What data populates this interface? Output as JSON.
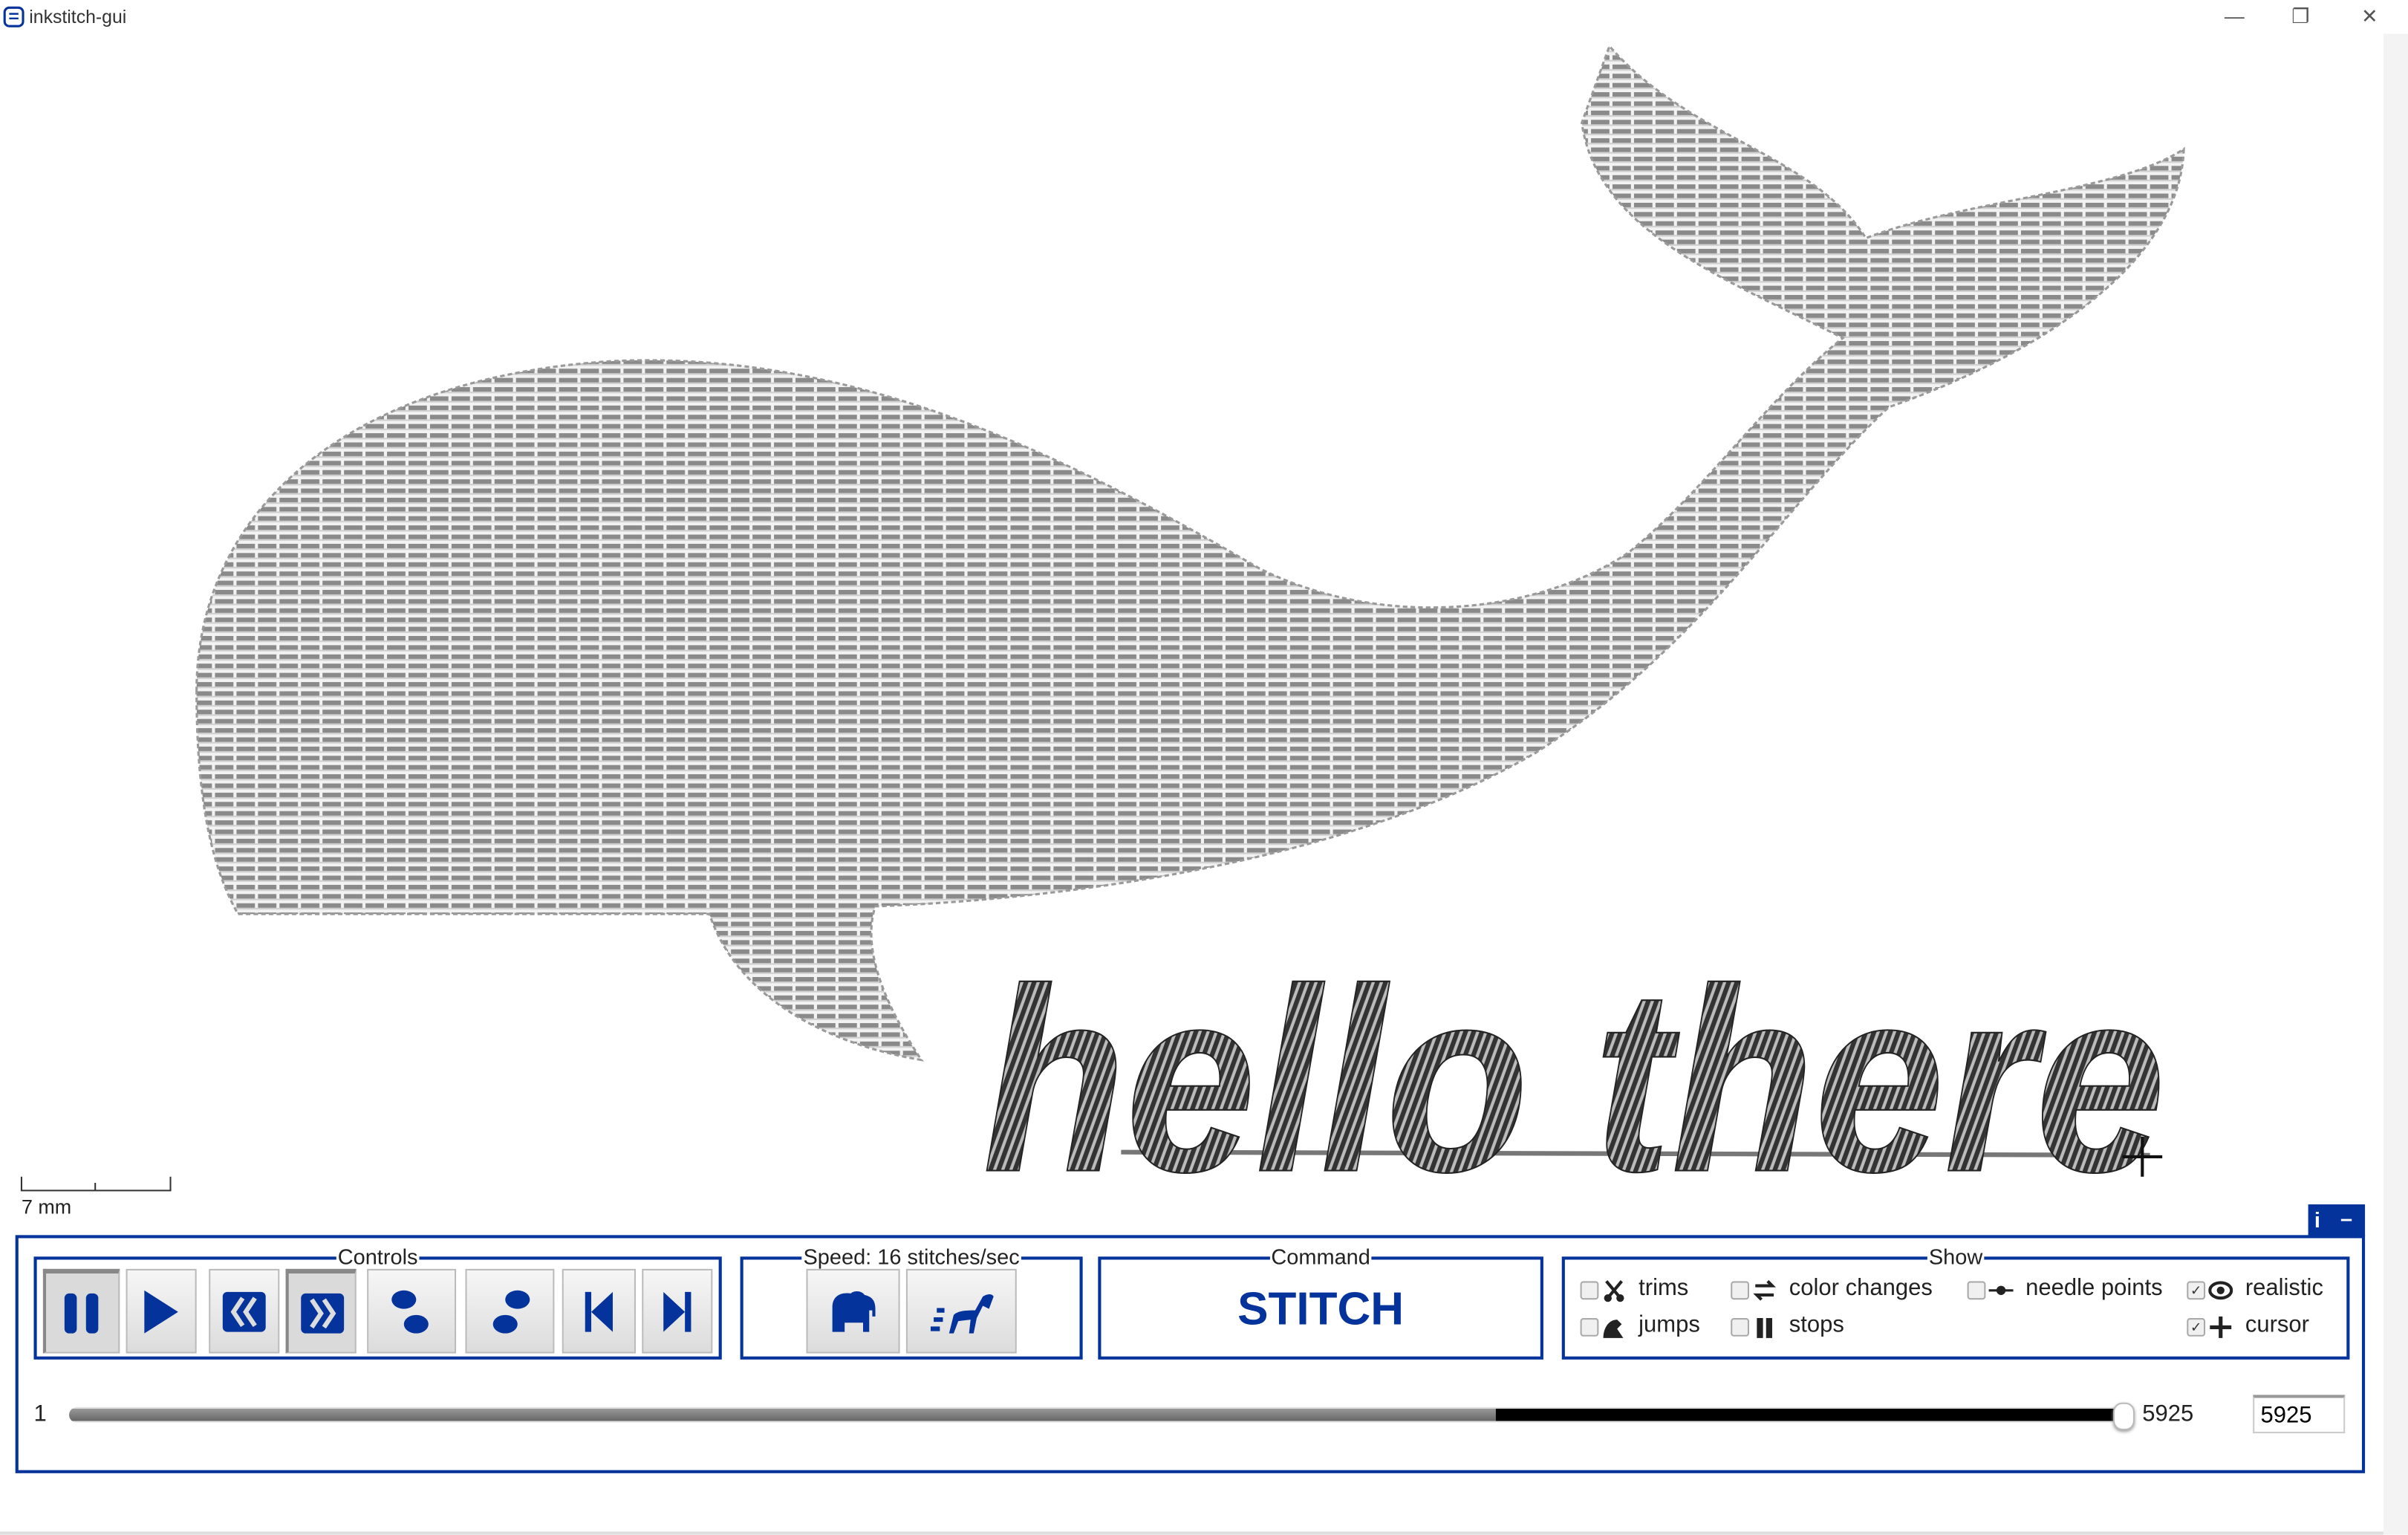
{
  "window": {
    "title": "inkstitch-gui",
    "icon": "inkstitch-app-icon",
    "controls": [
      "minimize",
      "restore",
      "close"
    ]
  },
  "canvas": {
    "design_text": "hello there",
    "design_shape": "whale",
    "scale_bar": {
      "label": "7 mm"
    },
    "cursor_icon": "crosshair-cursor"
  },
  "info_tab": {
    "info_icon": "i",
    "collapse_icon": "–"
  },
  "controls": {
    "label": "Controls",
    "buttons": [
      {
        "name": "pause",
        "icon": "pause-icon",
        "pressed": true
      },
      {
        "name": "play",
        "icon": "play-icon",
        "pressed": false
      },
      {
        "name": "reverse",
        "icon": "rewind-icon",
        "pressed": false
      },
      {
        "name": "forward",
        "icon": "fast-forward-icon",
        "pressed": true
      },
      {
        "name": "step-backward",
        "icon": "footsteps-back-icon",
        "pressed": false
      },
      {
        "name": "step-forward",
        "icon": "footsteps-forward-icon",
        "pressed": false
      },
      {
        "name": "first",
        "icon": "skip-to-start-icon",
        "pressed": false
      },
      {
        "name": "last",
        "icon": "skip-to-end-icon",
        "pressed": false
      }
    ]
  },
  "speed": {
    "label": "Speed: 16 stitches/sec",
    "buttons": [
      {
        "name": "slower",
        "icon": "elephant-icon"
      },
      {
        "name": "faster",
        "icon": "running-horse-icon"
      }
    ]
  },
  "command": {
    "label": "Command",
    "value": "STITCH"
  },
  "show": {
    "label": "Show",
    "options": [
      {
        "label": "trims",
        "icon": "scissors-icon",
        "checked": false
      },
      {
        "label": "color changes",
        "icon": "swap-arrows-icon",
        "checked": false
      },
      {
        "label": "needle points",
        "icon": "needle-point-icon",
        "checked": false
      },
      {
        "label": "realistic",
        "icon": "eye-icon",
        "checked": true
      },
      {
        "label": "jumps",
        "icon": "frog-icon",
        "checked": false
      },
      {
        "label": "stops",
        "icon": "stop-bars-icon",
        "checked": false
      },
      {
        "label": "cursor",
        "icon": "plus-icon",
        "checked": true
      }
    ]
  },
  "slider": {
    "min": "1",
    "max": "5925",
    "value": 5925,
    "color_change_at_fraction": 0.695,
    "input_value": "5925"
  },
  "colors": {
    "accent": "#05339c",
    "stitch_light": "#9a9a9a",
    "stitch_dark": "#3a3a3a"
  }
}
